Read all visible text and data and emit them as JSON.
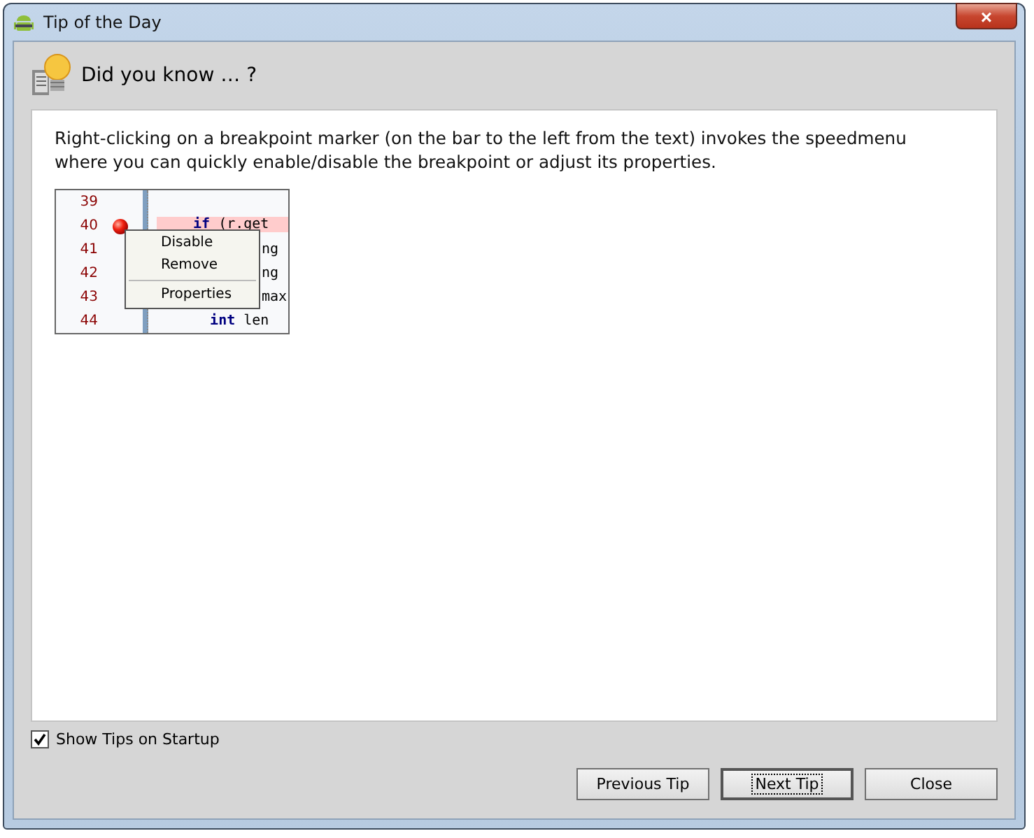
{
  "window": {
    "title": "Tip of the Day",
    "close_symbol": "×"
  },
  "header": {
    "title": "Did you know … ?"
  },
  "tip": {
    "text": "Right-clicking on a breakpoint marker (on the bar to the left from the text) invokes the speedmenu where you can quickly enable/disable the breakpoint or adjust its properties.",
    "code": [
      {
        "number": "39",
        "kind": "plain"
      },
      {
        "number": "40",
        "text": "**if** (r.get",
        "kind": "breakpoint"
      },
      {
        "number": "41",
        "text": "ng",
        "kind": "covered"
      },
      {
        "number": "42",
        "text": "ng",
        "kind": "covered"
      },
      {
        "number": "43",
        "text": "max",
        "kind": "covered"
      },
      {
        "number": "44",
        "text": "  **int** len",
        "kind": "plain"
      }
    ],
    "menu": [
      {
        "kind": "item",
        "label": "Disable"
      },
      {
        "kind": "item",
        "label": "Remove"
      },
      {
        "kind": "separator"
      },
      {
        "kind": "item",
        "label": "Properties"
      }
    ]
  },
  "show_tips": {
    "label": "Show Tips on Startup",
    "checked": true
  },
  "buttons": [
    {
      "label": "Previous Tip",
      "focused": false
    },
    {
      "label": "Next Tip",
      "focused": true
    },
    {
      "label": "Close",
      "focused": false
    }
  ]
}
